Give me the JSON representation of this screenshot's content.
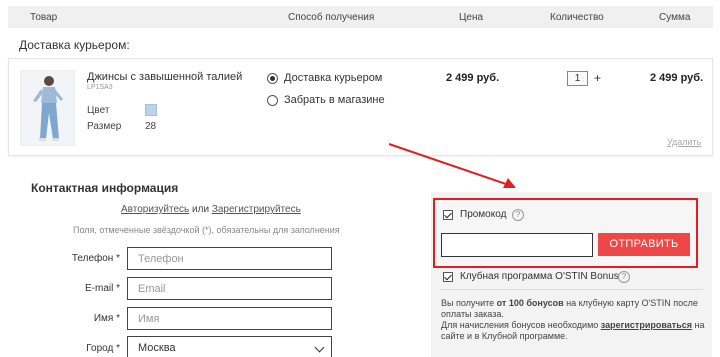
{
  "table_header": {
    "product": "Товар",
    "delivery_method": "Способ получения",
    "price": "Цена",
    "quantity": "Количество",
    "sum": "Сумма"
  },
  "delivery_section_title": "Доставка курьером:",
  "product": {
    "name": "Джинсы с завышенной талией",
    "sku": "LP1SA3",
    "color_label": "Цвет",
    "color_swatch": "#bcd3ea",
    "size_label": "Размер",
    "size_value": "28",
    "delivery_options": [
      {
        "label": "Доставка курьером",
        "selected": true
      },
      {
        "label": "Забрать в магазине",
        "selected": false
      }
    ],
    "price": "2 499 руб.",
    "quantity": "1",
    "quantity_plus": "+",
    "sum": "2 499 руб.",
    "remove_label": "Удалить"
  },
  "contact": {
    "title": "Контактная информация",
    "login_link": "Авторизуйтесь",
    "or_text": " или ",
    "register_link": "Зарегистрируйтесь",
    "hint": "Поля, отмеченные звёздочкой (*), обязательны для заполнения",
    "fields": [
      {
        "label": "Телефон *",
        "placeholder": "Телефон"
      },
      {
        "label": "E-mail *",
        "placeholder": "Email"
      },
      {
        "label": "Имя *",
        "placeholder": "Имя"
      },
      {
        "label": "Город *",
        "value": "Москва"
      }
    ]
  },
  "promo": {
    "checkbox_label": "Промокод",
    "help": "?",
    "input_value": "",
    "submit_label": "ОТПРАВИТЬ",
    "club_label": "Клубная программа O'STIN Bonus",
    "bonus_line1_pre": "Вы получите ",
    "bonus_line1_bold": "от 100 бонусов",
    "bonus_line1_post": " на клубную карту O'STIN после",
    "bonus_line2": "оплаты заказа.",
    "bonus_line3_pre": "Для начисления бонусов необходимо ",
    "bonus_line3_link": "зарегистрироваться",
    "bonus_line3_post": " на",
    "bonus_line4": "сайте и в Клубной программе."
  },
  "colors": {
    "accent_red": "#ee4747",
    "highlight_border": "#e02020"
  }
}
